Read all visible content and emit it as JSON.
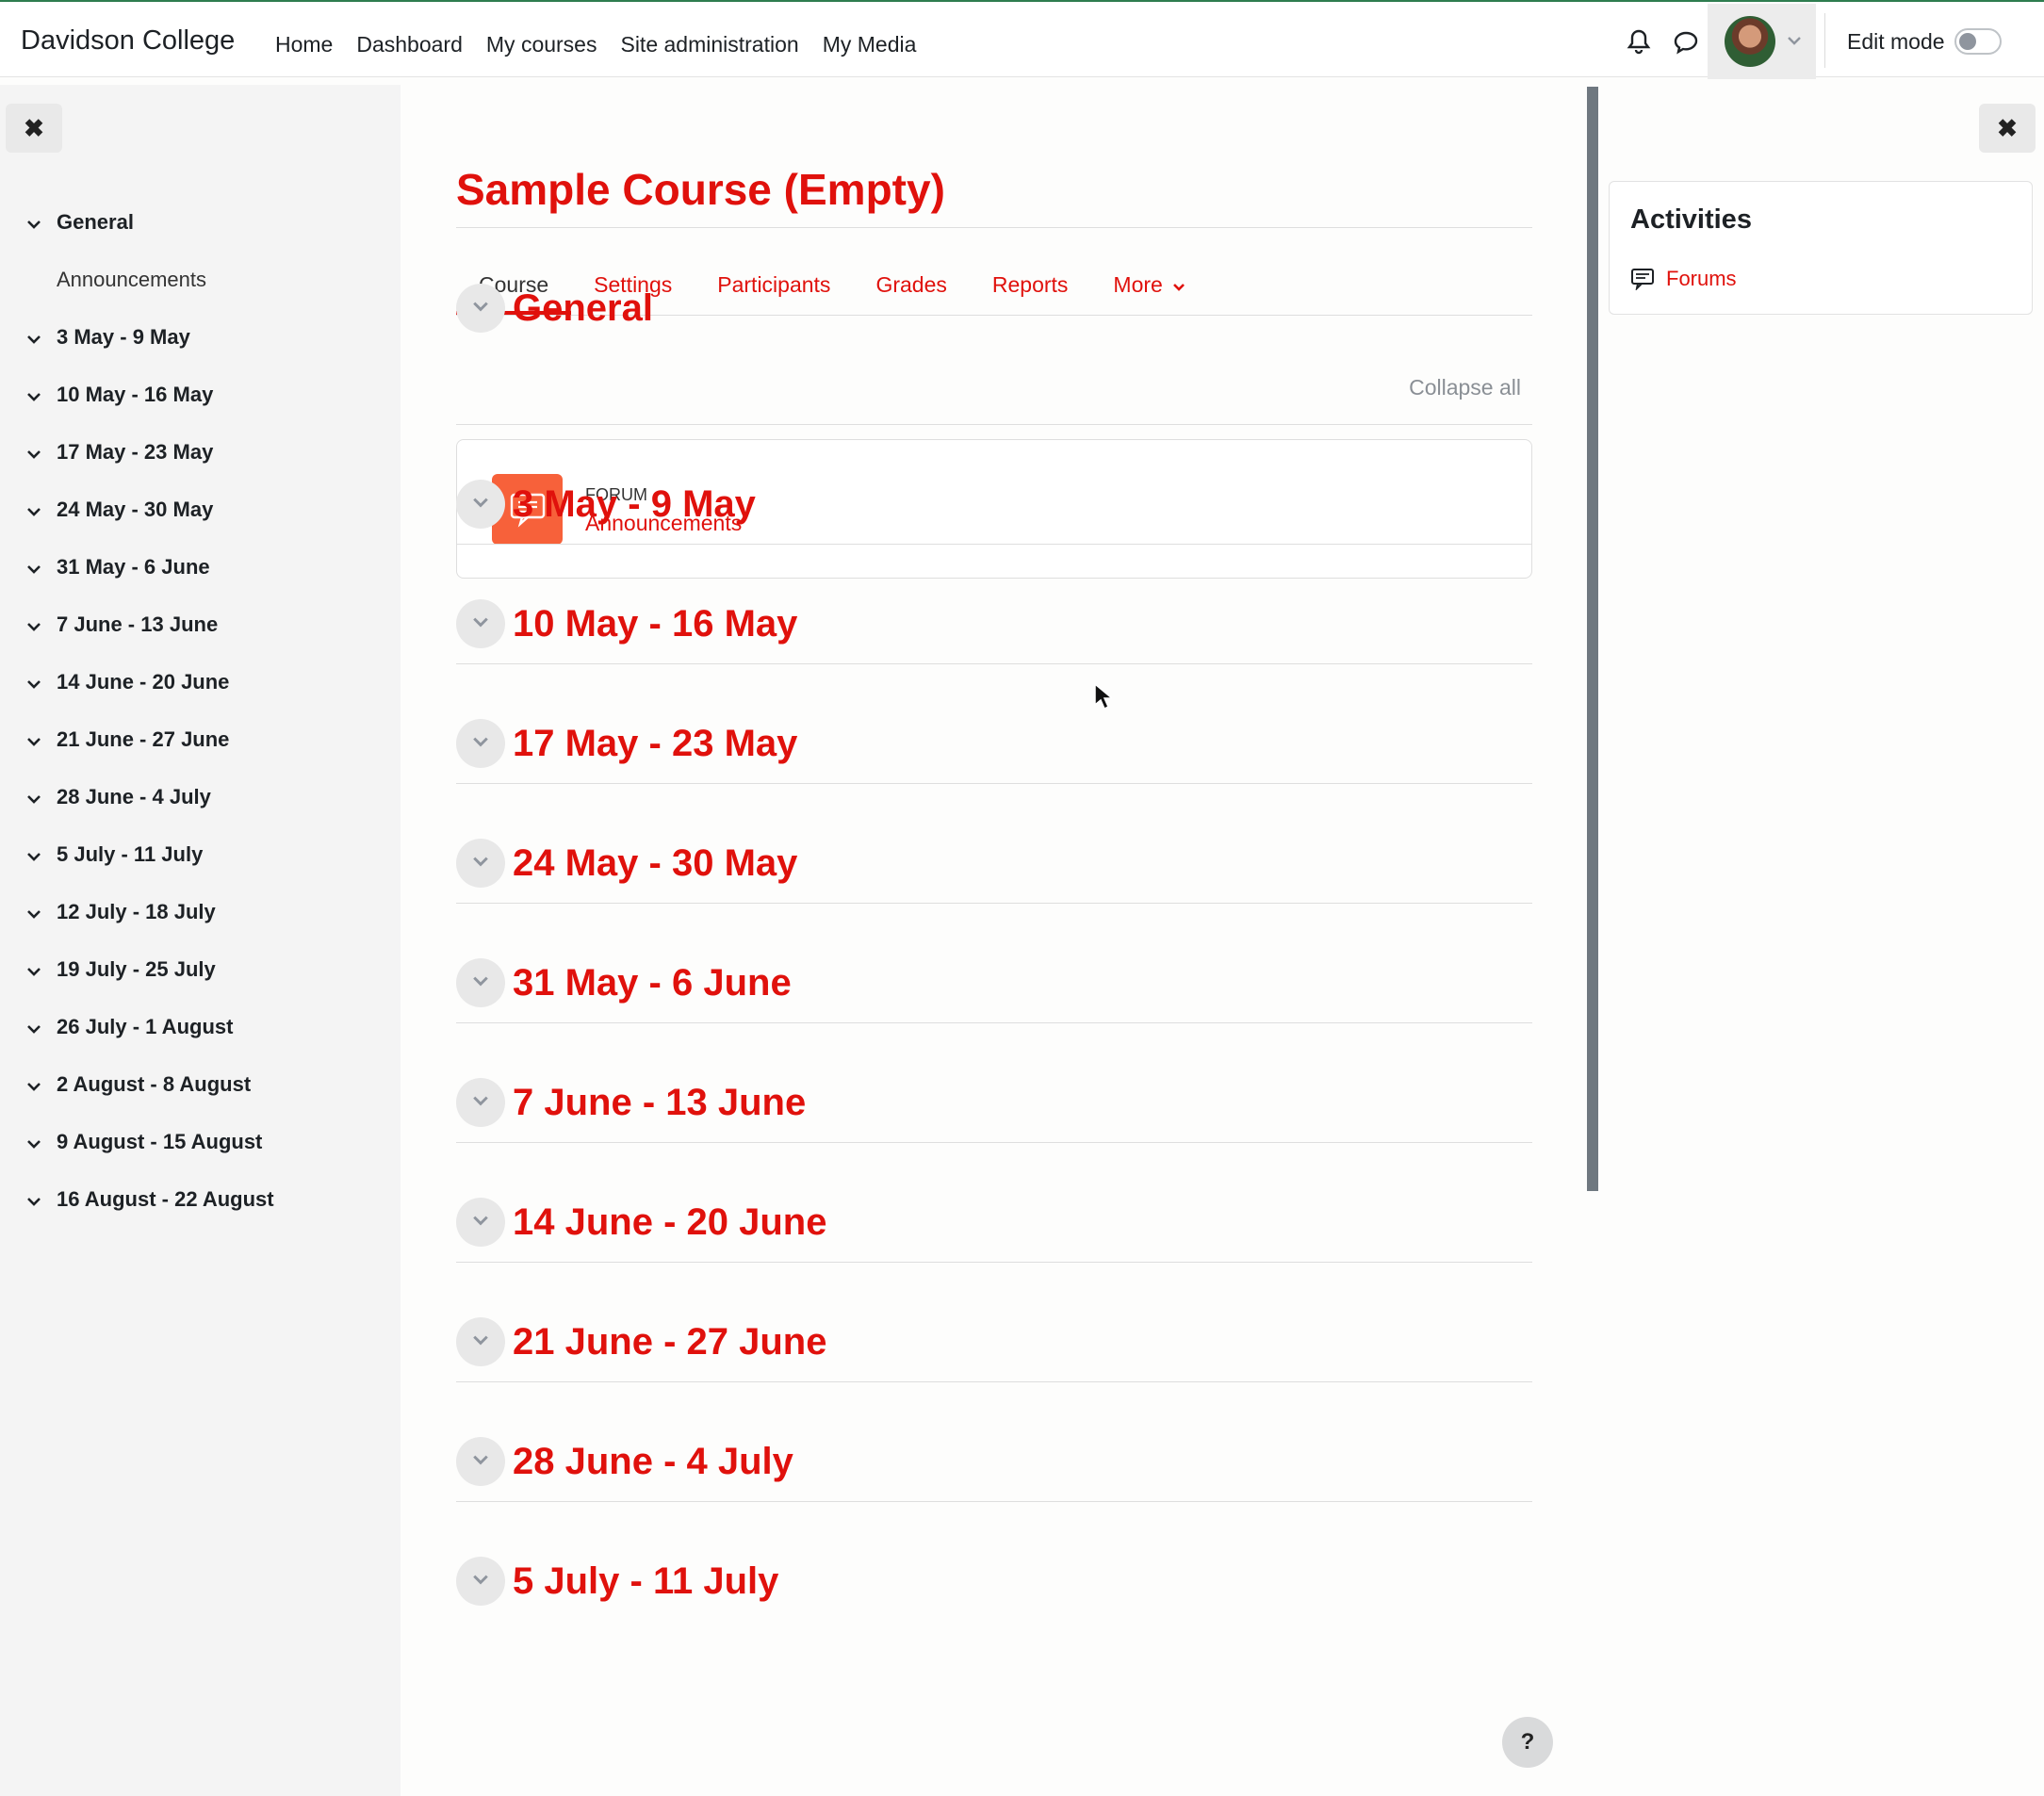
{
  "brand": "Davidson College",
  "nav": [
    "Home",
    "Dashboard",
    "My courses",
    "Site administration",
    "My Media"
  ],
  "edit_mode_label": "Edit mode",
  "course_title": "Sample Course (Empty)",
  "tabs": [
    "Course",
    "Settings",
    "Participants",
    "Grades",
    "Reports",
    "More"
  ],
  "collapse_all": "Collapse all",
  "course_index": [
    {
      "label": "General",
      "sub": [
        "Announcements"
      ]
    },
    {
      "label": "3 May - 9 May"
    },
    {
      "label": "10 May - 16 May"
    },
    {
      "label": "17 May - 23 May"
    },
    {
      "label": "24 May - 30 May"
    },
    {
      "label": "31 May - 6 June"
    },
    {
      "label": "7 June - 13 June"
    },
    {
      "label": "14 June - 20 June"
    },
    {
      "label": "21 June - 27 June"
    },
    {
      "label": "28 June - 4 July"
    },
    {
      "label": "5 July - 11 July"
    },
    {
      "label": "12 July - 18 July"
    },
    {
      "label": "19 July - 25 July"
    },
    {
      "label": "26 July - 1 August"
    },
    {
      "label": "2 August - 8 August"
    },
    {
      "label": "9 August - 15 August"
    },
    {
      "label": "16 August - 22 August"
    }
  ],
  "sections": [
    "General",
    "3 May - 9 May",
    "10 May - 16 May",
    "17 May - 23 May",
    "24 May - 30 May",
    "31 May - 6 June",
    "7 June - 13 June",
    "14 June - 20 June",
    "21 June - 27 June",
    "28 June - 4 July",
    "5 July - 11 July"
  ],
  "activity": {
    "type": "FORUM",
    "name": "Announcements"
  },
  "activities_block": {
    "title": "Activities",
    "item": "Forums"
  },
  "help_label": "?",
  "colors": {
    "accent": "#e0110c",
    "forum_icon_bg": "#f7613a"
  }
}
